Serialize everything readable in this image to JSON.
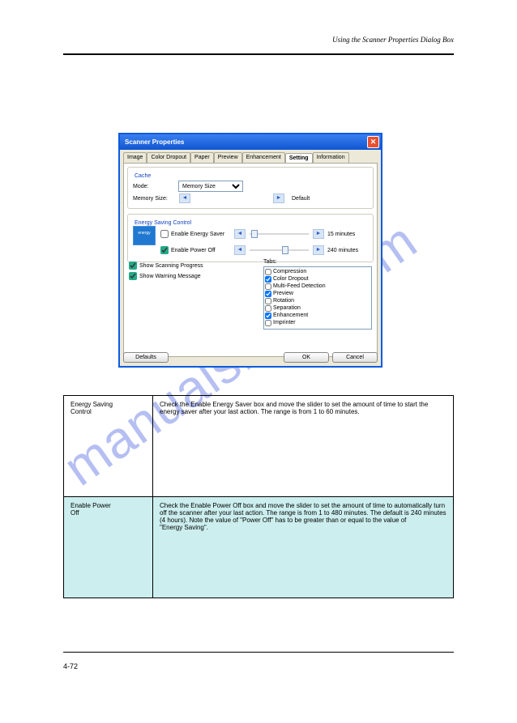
{
  "header": {
    "title": "Using the Scanner Properties Dialog Box"
  },
  "footer": {
    "page_number": "4-72"
  },
  "watermark": "manualshive.com",
  "dialog": {
    "title": "Scanner Properties",
    "close": "✕",
    "tabs": [
      "Image",
      "Color Dropout",
      "Paper",
      "Preview",
      "Enhancement",
      "Setting",
      "Information"
    ],
    "active_tab_index": 5,
    "cache": {
      "legend": "Cache",
      "mode_label": "Mode:",
      "mode_value": "Memory Size",
      "memory_label": "Memory Size:",
      "default_label": "Default"
    },
    "energy": {
      "legend": "Energy Saving Control",
      "enable_saver": "Enable Energy Saver",
      "enable_poweroff": "Enable Power Off",
      "saver_checked": false,
      "poweroff_checked": true,
      "saver_value": "15 minutes",
      "poweroff_value": "240 minutes",
      "logo_text": "energy"
    },
    "show_progress": {
      "label": "Show Scanning Progress",
      "checked": true
    },
    "show_warning": {
      "label": "Show Warning Message",
      "checked": true
    },
    "tabs_list": {
      "label": "Tabs:",
      "items": [
        {
          "label": "Compression",
          "checked": false
        },
        {
          "label": "Color Dropout",
          "checked": true
        },
        {
          "label": "Multi-Feed Detection",
          "checked": false
        },
        {
          "label": "Preview",
          "checked": true
        },
        {
          "label": "Rotation",
          "checked": false
        },
        {
          "label": "Separation",
          "checked": false
        },
        {
          "label": "Enhancement",
          "checked": true
        },
        {
          "label": "Imprinter",
          "checked": false
        }
      ]
    },
    "buttons": {
      "defaults": "Defaults",
      "ok": "OK",
      "cancel": "Cancel"
    }
  },
  "table": {
    "r1c1a": "Energy Saving",
    "r1c1b": "Control",
    "r1c2": "Check the Enable Energy Saver box and move the slider to set the amount of time to start the energy saver after your last action. The range is from 1 to 60 minutes.",
    "r2c1a": "Enable Power",
    "r2c1b": "Off",
    "r2c2a": "Check the Enable Power Off box and move the slider to set the amount of time to automatically turn off the scanner after your last action. The range is from 1 to 480 minutes. The default is 240 minutes (4 hours). Note the value of \"Power Off\" has to be greater than or equal to the value of",
    "r2c2b": "\"Energy Saving\"."
  }
}
